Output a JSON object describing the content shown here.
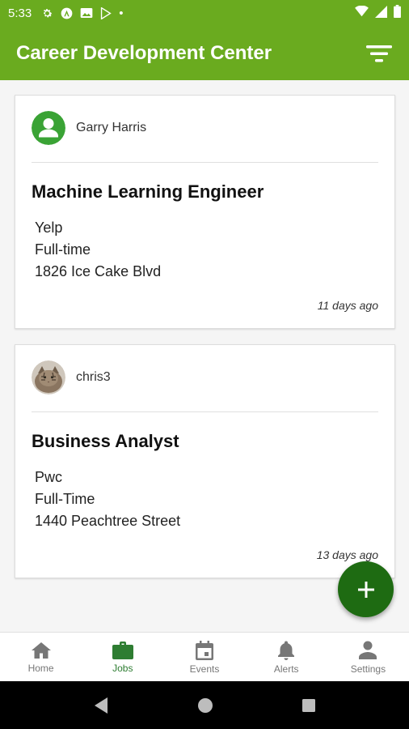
{
  "status_bar": {
    "time": "5:33",
    "dot": "•",
    "icons": [
      "settings-gear-icon",
      "app-a-icon",
      "photo-icon",
      "play-store-icon",
      "wifi-icon",
      "signal-icon",
      "battery-icon"
    ]
  },
  "app_bar": {
    "title": "Career Development Center",
    "filter_icon": "filter-list-icon"
  },
  "colors": {
    "app_bar": "#6aab1f",
    "fab": "#1e6b12",
    "active_nav": "#2e7d32",
    "inactive_nav": "#777777",
    "avatar_green": "#3aa335"
  },
  "jobs": [
    {
      "author": "Garry Harris",
      "avatar": "default-user-avatar-icon",
      "title": "Machine Learning Engineer",
      "company": "Yelp",
      "type": "Full-time",
      "address": "1826 Ice Cake Blvd",
      "posted": "11 days ago"
    },
    {
      "author": "chris3",
      "avatar": "cat-photo-avatar",
      "title": "Business Analyst",
      "company": "Pwc",
      "type": "Full-Time",
      "address": "1440 Peachtree Street",
      "posted": "13 days ago"
    }
  ],
  "fab": {
    "icon": "plus-icon"
  },
  "bottom_nav": {
    "active": "Jobs",
    "items": [
      {
        "label": "Home",
        "icon": "home-icon"
      },
      {
        "label": "Jobs",
        "icon": "briefcase-icon"
      },
      {
        "label": "Events",
        "icon": "calendar-icon"
      },
      {
        "label": "Alerts",
        "icon": "bell-icon"
      },
      {
        "label": "Settings",
        "icon": "person-icon"
      }
    ]
  },
  "system_nav": {
    "icons": [
      "back-icon",
      "home-circle-icon",
      "recents-icon"
    ]
  }
}
